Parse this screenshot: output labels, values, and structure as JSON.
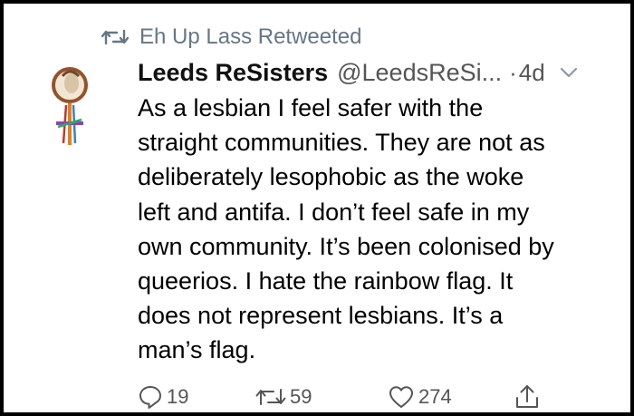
{
  "retweet_banner": {
    "icon": "retweet-icon",
    "label": "Eh Up Lass Retweeted"
  },
  "tweet": {
    "avatar_icon": "venus-symbol-avatar",
    "display_name": "Leeds ReSisters",
    "handle": "@LeedsReSi...",
    "separator": "·",
    "time": "4d",
    "menu_icon": "chevron-down-icon",
    "text_lines": [
      "As a lesbian I feel safer with the",
      "straight communities. They are not as",
      "deliberately lesophobic as the woke",
      "left and antifa. I don’t feel safe in my",
      "own community. It’s been colonised by",
      "queerios. I hate the rainbow flag. It",
      "does not represent lesbians. It’s a",
      "man’s flag."
    ]
  },
  "actions": {
    "reply": {
      "icon": "reply-icon",
      "count": "19"
    },
    "retweet": {
      "icon": "retweet-icon",
      "count": "59"
    },
    "like": {
      "icon": "heart-icon",
      "count": "274"
    },
    "share": {
      "icon": "share-icon"
    }
  },
  "colors": {
    "secondary_text": "#657786",
    "primary_text": "#000000",
    "frame": "#000000",
    "background": "#ffffff"
  }
}
